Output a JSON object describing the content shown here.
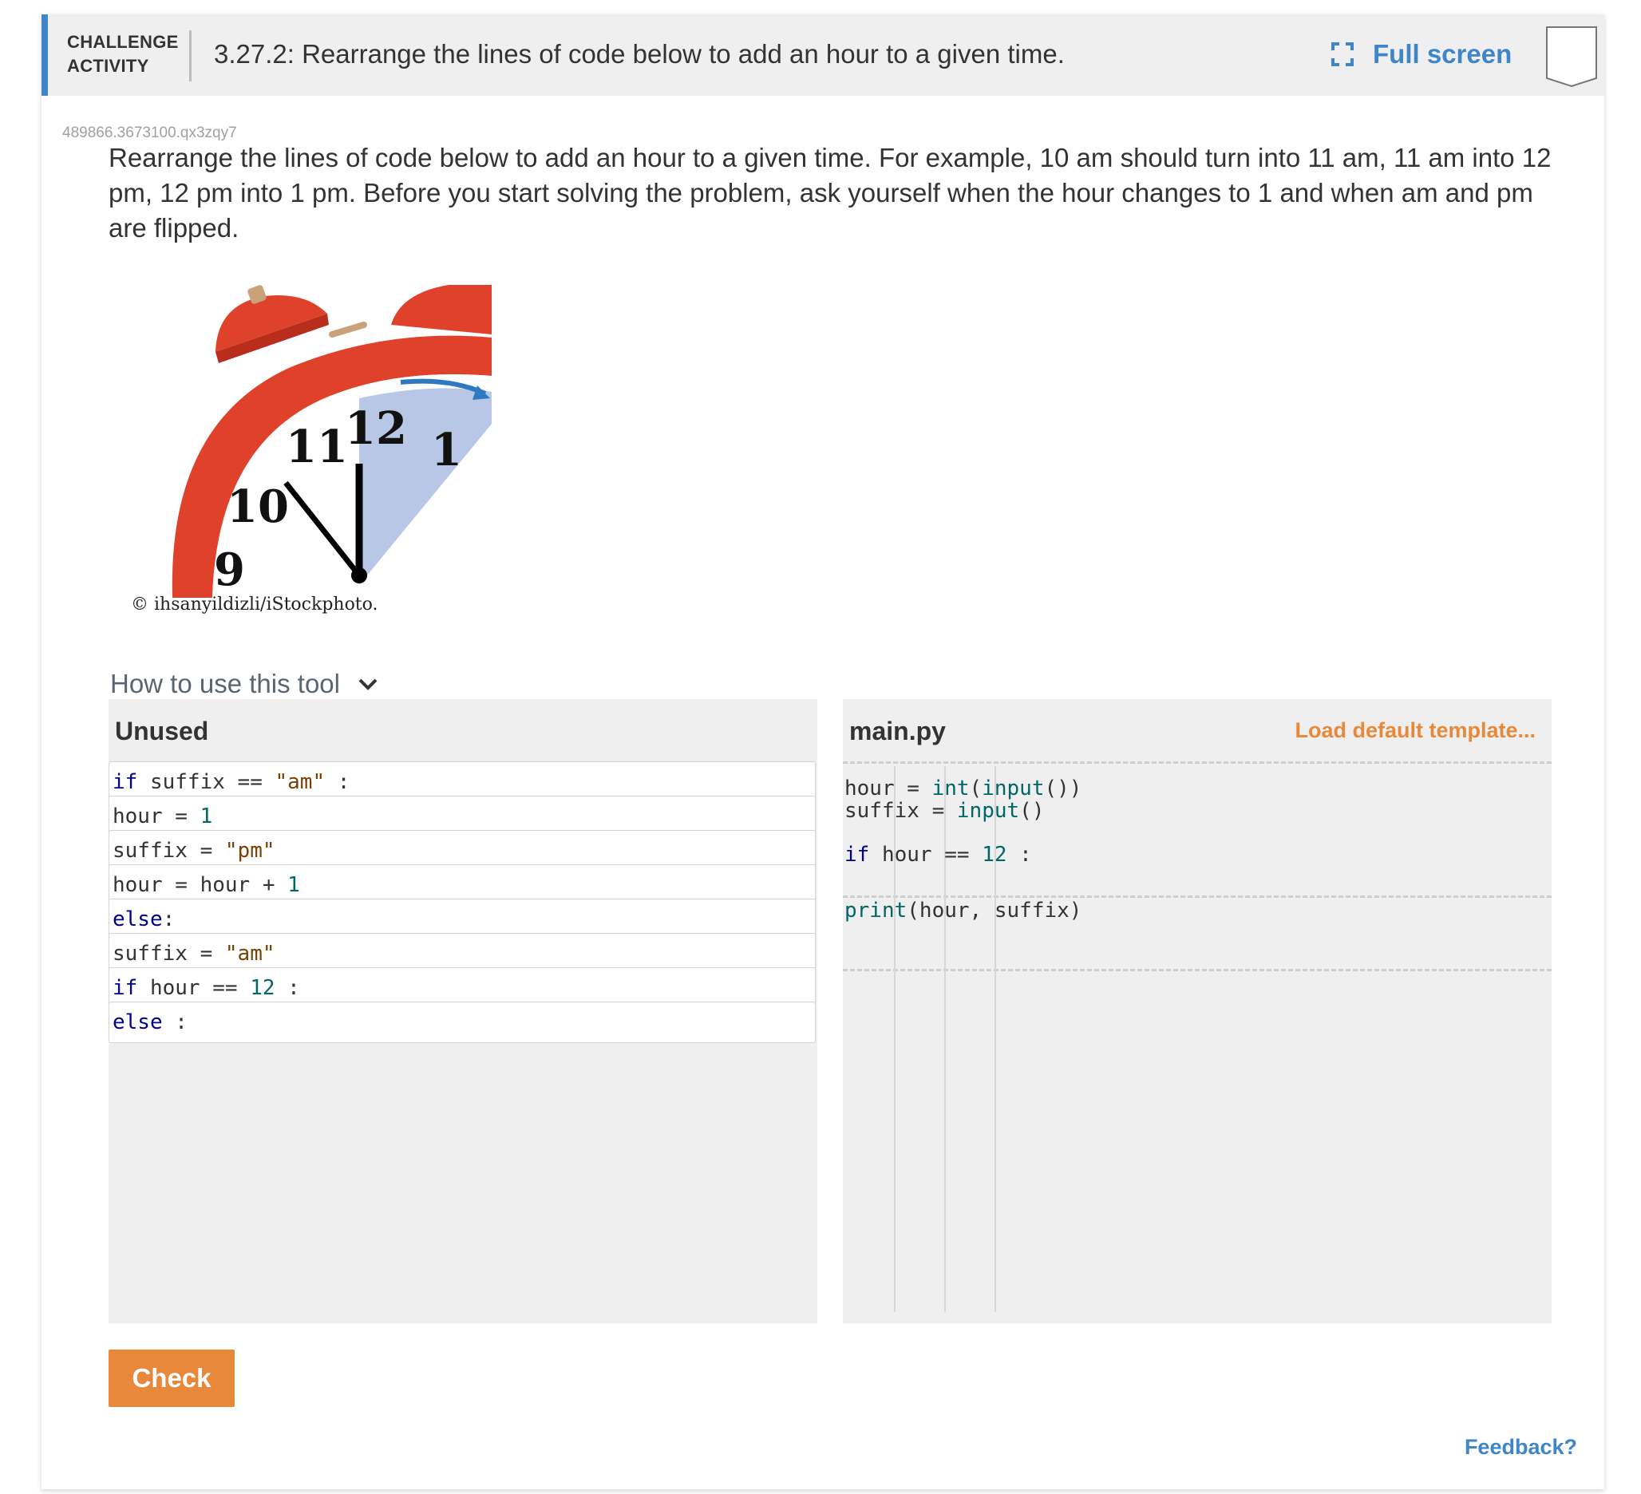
{
  "header": {
    "label_line1": "CHALLENGE",
    "label_line2": "ACTIVITY",
    "title": "3.27.2: Rearrange the lines of code below to add an hour to a given time.",
    "fullscreen_label": "Full screen"
  },
  "activity_id": "489866.3673100.qx3zqy7",
  "prompt": "Rearrange the lines of code below to add an hour to a given time. For example, 10 am should turn into 11 am, 11 am into 12 pm, 12 pm into 1 pm. Before you start solving the problem, ask yourself when the hour changes to 1 and when am and pm are flipped.",
  "image": {
    "credit": "© ihsanyildizli/iStockphoto.",
    "clock_numbers": [
      "9",
      "10",
      "11",
      "12",
      "1"
    ]
  },
  "howto_label": "How to use this tool",
  "unused": {
    "title": "Unused",
    "blocks": [
      [
        {
          "t": "if",
          "c": "kw"
        },
        {
          "t": " suffix == ",
          "c": "pl"
        },
        {
          "t": "\"am\"",
          "c": "str"
        },
        {
          "t": " :",
          "c": "pl"
        }
      ],
      [
        {
          "t": "hour = ",
          "c": "pl"
        },
        {
          "t": "1",
          "c": "num"
        }
      ],
      [
        {
          "t": "suffix = ",
          "c": "pl"
        },
        {
          "t": "\"pm\"",
          "c": "str"
        }
      ],
      [
        {
          "t": "hour = hour + ",
          "c": "pl"
        },
        {
          "t": "1",
          "c": "num"
        }
      ],
      [
        {
          "t": "else",
          "c": "kw"
        },
        {
          "t": ":",
          "c": "pl"
        }
      ],
      [
        {
          "t": "suffix = ",
          "c": "pl"
        },
        {
          "t": "\"am\"",
          "c": "str"
        }
      ],
      [
        {
          "t": "if",
          "c": "kw"
        },
        {
          "t": " hour == ",
          "c": "pl"
        },
        {
          "t": "12",
          "c": "num"
        },
        {
          "t": " :",
          "c": "pl"
        }
      ],
      [
        {
          "t": "else",
          "c": "kw"
        },
        {
          "t": " :",
          "c": "pl"
        }
      ]
    ]
  },
  "main": {
    "title": "main.py",
    "load_label": "Load default template...",
    "lines": [
      [
        {
          "t": "hour = ",
          "c": "pl"
        },
        {
          "t": "int",
          "c": "fn"
        },
        {
          "t": "(",
          "c": "pl"
        },
        {
          "t": "input",
          "c": "fn"
        },
        {
          "t": "())",
          "c": "pl"
        }
      ],
      [
        {
          "t": "suffix = ",
          "c": "pl"
        },
        {
          "t": "input",
          "c": "fn"
        },
        {
          "t": "()",
          "c": "pl"
        }
      ],
      [
        {
          "t": "if",
          "c": "kw"
        },
        {
          "t": " hour == ",
          "c": "pl"
        },
        {
          "t": "12",
          "c": "num"
        },
        {
          "t": " :",
          "c": "pl"
        }
      ],
      [
        {
          "t": "print",
          "c": "fn"
        },
        {
          "t": "(hour, suffix)",
          "c": "pl"
        }
      ]
    ]
  },
  "check_label": "Check",
  "feedback_label": "Feedback?",
  "colors": {
    "accent_blue": "#3f86c9",
    "accent_orange": "#e8883a",
    "keyword": "#000088",
    "string": "#7a3e00",
    "number": "#006666"
  }
}
